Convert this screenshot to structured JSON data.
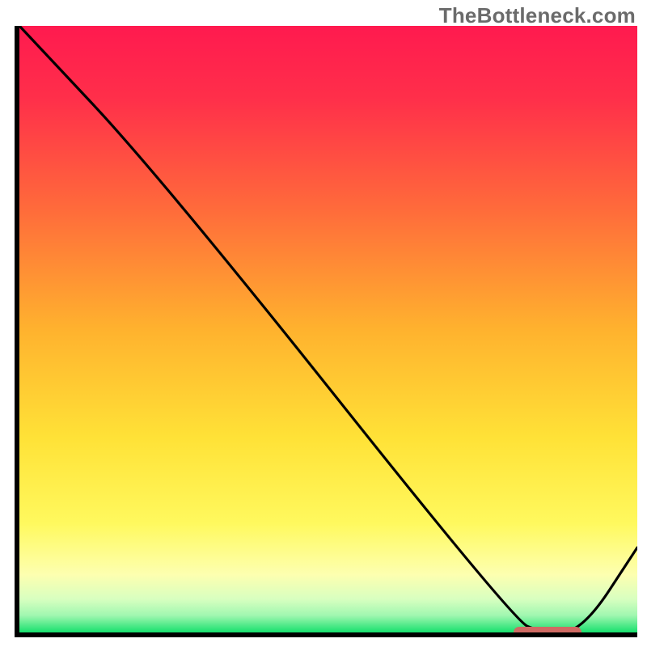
{
  "watermark": "TheBottleneck.com",
  "chart_data": {
    "type": "line",
    "title": "",
    "xlabel": "",
    "ylabel": "",
    "xlim": [
      0,
      100
    ],
    "ylim": [
      0,
      100
    ],
    "x": [
      0,
      23,
      80,
      84.5,
      91,
      100
    ],
    "values": [
      100,
      75,
      2,
      0,
      0,
      14
    ],
    "marker_range_x": [
      80,
      91
    ],
    "marker_y": 0,
    "gradient_stops": [
      {
        "offset": 0.0,
        "color": "#ff1a4f"
      },
      {
        "offset": 0.12,
        "color": "#ff2f4a"
      },
      {
        "offset": 0.3,
        "color": "#ff6a3b"
      },
      {
        "offset": 0.5,
        "color": "#ffb22e"
      },
      {
        "offset": 0.68,
        "color": "#ffe237"
      },
      {
        "offset": 0.82,
        "color": "#fff95e"
      },
      {
        "offset": 0.905,
        "color": "#fdffb0"
      },
      {
        "offset": 0.945,
        "color": "#d8ffc0"
      },
      {
        "offset": 0.972,
        "color": "#a0f7b0"
      },
      {
        "offset": 1.0,
        "color": "#17e06d"
      }
    ]
  }
}
